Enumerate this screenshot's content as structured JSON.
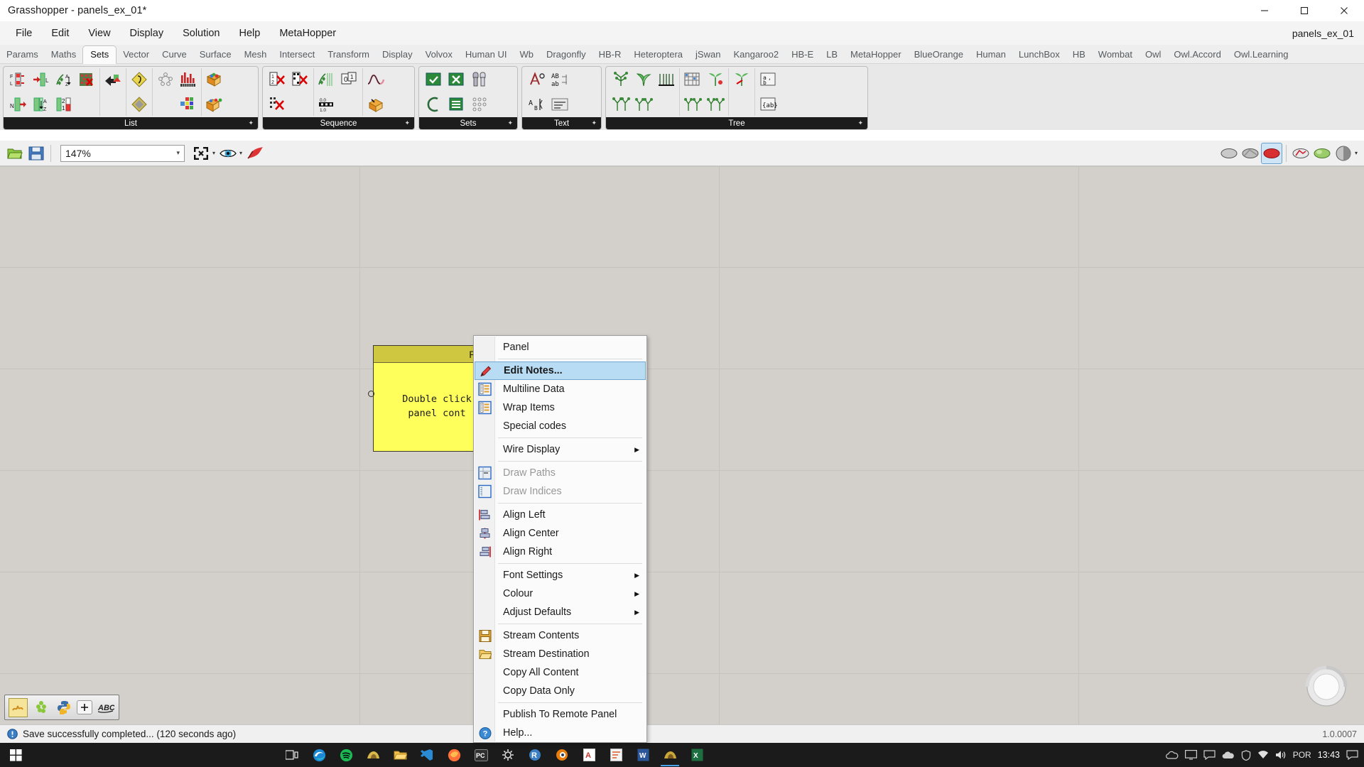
{
  "window": {
    "title": "Grasshopper - panels_ex_01*",
    "minimize_label": "Minimize",
    "maximize_label": "Maximize",
    "close_label": "Close"
  },
  "menubar": {
    "items": [
      {
        "label": "File"
      },
      {
        "label": "Edit"
      },
      {
        "label": "View"
      },
      {
        "label": "Display"
      },
      {
        "label": "Solution"
      },
      {
        "label": "Help"
      },
      {
        "label": "MetaHopper"
      }
    ],
    "document_name": "panels_ex_01"
  },
  "tabs": [
    {
      "label": "Params",
      "active": false
    },
    {
      "label": "Maths",
      "active": false
    },
    {
      "label": "Sets",
      "active": true
    },
    {
      "label": "Vector",
      "active": false
    },
    {
      "label": "Curve",
      "active": false
    },
    {
      "label": "Surface",
      "active": false
    },
    {
      "label": "Mesh",
      "active": false
    },
    {
      "label": "Intersect",
      "active": false
    },
    {
      "label": "Transform",
      "active": false
    },
    {
      "label": "Display",
      "active": false
    },
    {
      "label": "Volvox",
      "active": false
    },
    {
      "label": "Human UI",
      "active": false
    },
    {
      "label": "Wb",
      "active": false
    },
    {
      "label": "Dragonfly",
      "active": false
    },
    {
      "label": "HB-R",
      "active": false
    },
    {
      "label": "Heteroptera",
      "active": false
    },
    {
      "label": "jSwan",
      "active": false
    },
    {
      "label": "Kangaroo2",
      "active": false
    },
    {
      "label": "HB-E",
      "active": false
    },
    {
      "label": "LB",
      "active": false
    },
    {
      "label": "MetaHopper",
      "active": false
    },
    {
      "label": "BlueOrange",
      "active": false
    },
    {
      "label": "Human",
      "active": false
    },
    {
      "label": "LunchBox",
      "active": false
    },
    {
      "label": "HB",
      "active": false
    },
    {
      "label": "Wombat",
      "active": false
    },
    {
      "label": "Owl",
      "active": false
    },
    {
      "label": "Owl.Accord",
      "active": false
    },
    {
      "label": "Owl.Learning",
      "active": false
    }
  ],
  "ribbon": {
    "groups": [
      {
        "label": "List",
        "pin": "✦"
      },
      {
        "label": "Sequence",
        "pin": "✦"
      },
      {
        "label": "Sets",
        "pin": "✦"
      },
      {
        "label": "Text",
        "pin": "✦"
      },
      {
        "label": "Tree",
        "pin": "✦"
      }
    ]
  },
  "canvas_toolbar": {
    "open_label": "Open Document",
    "save_label": "Save Document",
    "zoom_value": "147%",
    "zoom_extents_label": "Zoom Extents",
    "preview_label": "Preview Settings",
    "paint_label": "Document Preview Settings",
    "right_icons": [
      {
        "name": "preview-off-icon"
      },
      {
        "name": "preview-shaded-icon"
      },
      {
        "name": "preview-selected-icon"
      },
      {
        "name": "draw-icons-icon"
      },
      {
        "name": "draw-fancy-icon"
      },
      {
        "name": "sphere-preview-icon"
      },
      {
        "name": "sphere-preview-dropdown-icon"
      }
    ]
  },
  "panel_component": {
    "title": "Panel",
    "content_line1": "Double click",
    "content_line2": "panel cont"
  },
  "context_menu": {
    "header": "Panel",
    "items": [
      {
        "label": "Edit Notes...",
        "icon": "pencil-icon",
        "selected": true,
        "bold": true,
        "disabled": false,
        "submenu": false
      },
      {
        "label": "Multiline Data",
        "icon": "multiline-icon",
        "selected": false,
        "bold": false,
        "disabled": false,
        "submenu": false
      },
      {
        "label": "Wrap Items",
        "icon": "wrap-icon",
        "selected": false,
        "bold": false,
        "disabled": false,
        "submenu": false
      },
      {
        "label": "Special codes",
        "icon": "",
        "selected": false,
        "bold": false,
        "disabled": false,
        "submenu": false
      },
      {
        "sep": true
      },
      {
        "label": "Wire Display",
        "icon": "",
        "selected": false,
        "bold": false,
        "disabled": false,
        "submenu": true
      },
      {
        "sep": true
      },
      {
        "label": "Draw Paths",
        "icon": "draw-paths-icon",
        "selected": false,
        "bold": false,
        "disabled": true,
        "submenu": false
      },
      {
        "label": "Draw Indices",
        "icon": "draw-indices-icon",
        "selected": false,
        "bold": false,
        "disabled": true,
        "submenu": false
      },
      {
        "sep": true
      },
      {
        "label": "Align Left",
        "icon": "align-left-icon",
        "selected": false,
        "bold": false,
        "disabled": false,
        "submenu": false
      },
      {
        "label": "Align Center",
        "icon": "align-center-icon",
        "selected": false,
        "bold": false,
        "disabled": false,
        "submenu": false
      },
      {
        "label": "Align Right",
        "icon": "align-right-icon",
        "selected": false,
        "bold": false,
        "disabled": false,
        "submenu": false
      },
      {
        "sep": true
      },
      {
        "label": "Font Settings",
        "icon": "",
        "selected": false,
        "bold": false,
        "disabled": false,
        "submenu": true
      },
      {
        "label": "Colour",
        "icon": "",
        "selected": false,
        "bold": false,
        "disabled": false,
        "submenu": true
      },
      {
        "label": "Adjust Defaults",
        "icon": "",
        "selected": false,
        "bold": false,
        "disabled": false,
        "submenu": true
      },
      {
        "sep": true
      },
      {
        "label": "Stream Contents",
        "icon": "save-icon",
        "selected": false,
        "bold": false,
        "disabled": false,
        "submenu": false
      },
      {
        "label": "Stream Destination",
        "icon": "folder-icon",
        "selected": false,
        "bold": false,
        "disabled": false,
        "submenu": false
      },
      {
        "label": "Copy All Content",
        "icon": "",
        "selected": false,
        "bold": false,
        "disabled": false,
        "submenu": false
      },
      {
        "label": "Copy Data Only",
        "icon": "",
        "selected": false,
        "bold": false,
        "disabled": false,
        "submenu": false
      },
      {
        "sep": true
      },
      {
        "label": "Publish To Remote Panel",
        "icon": "",
        "selected": false,
        "bold": false,
        "disabled": false,
        "submenu": false
      },
      {
        "label": "Help...",
        "icon": "help-icon",
        "selected": false,
        "bold": false,
        "disabled": false,
        "submenu": false
      }
    ]
  },
  "bottom_toolbar": {
    "items": [
      {
        "name": "grasshopper-icon"
      },
      {
        "name": "hops-icon"
      },
      {
        "name": "python-icon"
      },
      {
        "name": "add-icon"
      },
      {
        "name": "abc-icon"
      }
    ]
  },
  "statusbar": {
    "message": "Save successfully completed... (120 seconds ago)",
    "version": "1.0.0007"
  },
  "taskbar": {
    "clock_time": "13:43",
    "language": "POR",
    "apps": [
      {
        "name": "task-view-icon"
      },
      {
        "name": "edge-icon"
      },
      {
        "name": "spotify-icon"
      },
      {
        "name": "rhino-icon"
      },
      {
        "name": "explorer-icon"
      },
      {
        "name": "vscode-icon"
      },
      {
        "name": "firefox-icon"
      },
      {
        "name": "pc-icon"
      },
      {
        "name": "settings-icon"
      },
      {
        "name": "r-studio-icon"
      },
      {
        "name": "blender-icon"
      },
      {
        "name": "acrobat-icon"
      },
      {
        "name": "notes-icon"
      },
      {
        "name": "word-icon"
      },
      {
        "name": "grasshopper-task-icon"
      },
      {
        "name": "excel-icon"
      }
    ],
    "tray": [
      {
        "name": "onedrive-icon"
      },
      {
        "name": "monitor-icon"
      },
      {
        "name": "chat-icon"
      },
      {
        "name": "cloud-icon"
      },
      {
        "name": "shield-icon"
      },
      {
        "name": "network-icon"
      },
      {
        "name": "volume-icon"
      }
    ]
  },
  "colors": {
    "panel_header": "#cfc73f",
    "panel_body": "#ffff5c",
    "menu_highlight": "#b8dcf4",
    "canvas_bg": "#d3d0cb",
    "taskbar_bg": "#1b1b1b"
  }
}
